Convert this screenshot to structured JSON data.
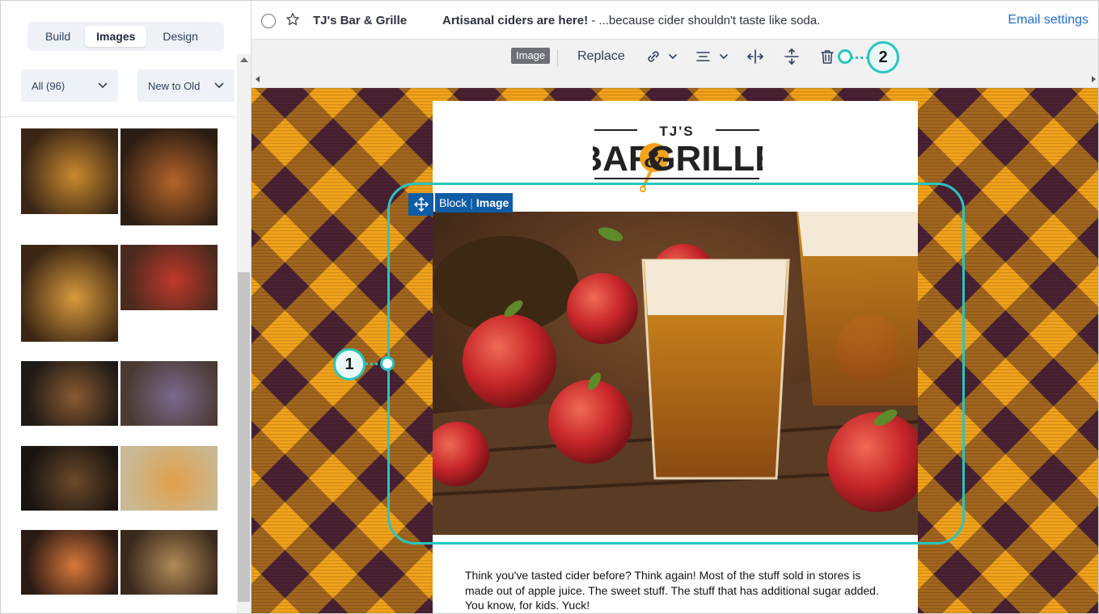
{
  "sidebar": {
    "tabs": [
      {
        "label": "Build",
        "active": false
      },
      {
        "label": "Images",
        "active": true
      },
      {
        "label": "Design",
        "active": false
      }
    ],
    "filter": {
      "selected": "All (96)"
    },
    "sort": {
      "selected": "New to Old"
    },
    "thumbnails": [
      {
        "subject": "beer and burger on bar",
        "colors": [
          "#3a2616",
          "#c98a2e"
        ]
      },
      {
        "subject": "chicken wings and beer",
        "colors": [
          "#2d1e14",
          "#b5642a"
        ]
      },
      {
        "subject": "burger and beers",
        "colors": [
          "#3b2614",
          "#d89a3c"
        ]
      },
      {
        "subject": "apples and cider",
        "colors": [
          "#4a2a1e",
          "#c0392b"
        ]
      },
      {
        "subject": "steak and fries",
        "colors": [
          "#1e1a16",
          "#8a5a32"
        ]
      },
      {
        "subject": "beer flight on barrels",
        "colors": [
          "#4b3a33",
          "#7a6a8c"
        ]
      },
      {
        "subject": "fans watching game at bar",
        "colors": [
          "#1a1410",
          "#6b4a2a"
        ]
      },
      {
        "subject": "pizza and salami",
        "colors": [
          "#c9b893",
          "#e2a04a"
        ]
      },
      {
        "subject": "pizza in pan",
        "colors": [
          "#2a1a14",
          "#d9783a"
        ]
      },
      {
        "subject": "friends toasting beers",
        "colors": [
          "#3a2a1c",
          "#b08a58"
        ]
      }
    ]
  },
  "topbar": {
    "from": "TJ's Bar & Grille",
    "subject_bold": "Artisanal ciders are here!",
    "subject_rest": " - ...because cider shouldn't taste like soda.",
    "email_settings": "Email settings"
  },
  "toolbar": {
    "badge": "Image",
    "replace": "Replace",
    "icons": [
      "link-icon",
      "align-icon",
      "resize-width-icon",
      "resize-height-icon",
      "trash-icon"
    ]
  },
  "email": {
    "logo": {
      "small": "TJ'S",
      "left": "BAR",
      "amp": "&",
      "right": "GRILLE"
    },
    "block_label": {
      "block": "Block",
      "type": "Image"
    },
    "hero_subject": "glasses of cider with red apples",
    "body_text": "Think you've tasted cider before? Think again! Most of the stuff sold in stores is made out of apple juice. The sweet stuff. The stuff that has additional sugar added. You know, for kids. Yuck!"
  },
  "callouts": [
    {
      "number": "1"
    },
    {
      "number": "2"
    }
  ],
  "colors": {
    "accent": "#27c6c1",
    "link": "#1f6fd1",
    "block_blue": "#0d5ca5",
    "plaid_orange": "#f2a31b",
    "plaid_purple": "#4a2233"
  }
}
